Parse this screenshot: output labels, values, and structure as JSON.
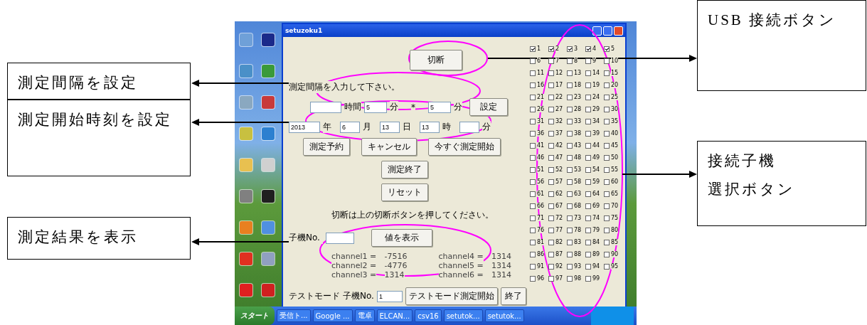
{
  "callouts": [
    {
      "text": "測定間隔を設定"
    },
    {
      "text": "測定開始時刻を設定"
    },
    {
      "text": "測定結果を表示"
    },
    {
      "text": "USB 接続ボタン"
    },
    {
      "lines": [
        "接続子機",
        "選択ボタン"
      ]
    }
  ],
  "screenshot": {
    "window": {
      "title": "setuzoku1",
      "disconnect_button": "切断",
      "interval_prompt": "測定間隔を入力して下さい。",
      "interval": {
        "hours": {
          "unit": "時間"
        },
        "minutes": {
          "value": "5",
          "unit": "分"
        },
        "separator": "*",
        "count": {
          "value": "5",
          "unit": "分"
        },
        "set_button": "設定"
      },
      "start_time": [
        {
          "value": "2013",
          "unit": "年"
        },
        {
          "value": "6",
          "unit": "月"
        },
        {
          "value": "13",
          "unit": "日"
        },
        {
          "value": "13",
          "unit": "時"
        },
        {
          "unit": "分"
        }
      ],
      "action_buttons": [
        "測定予約",
        "キャンセル",
        "今すぐ測定開始"
      ],
      "end_button": "測定終了",
      "reset_button": "リセット",
      "disconnect_message": "切断は上の切断ボタンを押してください。",
      "unit_label": "子機No.",
      "show_button": "値を表示",
      "channels": [
        {
          "name": "channel1 =",
          "value": "-7516"
        },
        {
          "name": "channel2 =",
          "value": "-4776"
        },
        {
          "name": "channel3 =",
          "value": "1314"
        },
        {
          "name": "channel4 =",
          "value": "1314"
        },
        {
          "name": "channel5 =",
          "value": "1314"
        },
        {
          "name": "channel6 =",
          "value": "1314"
        }
      ],
      "test_mode": {
        "label": "テストモード",
        "unit_label": "子機No.",
        "unit_value": "1",
        "start_button": "テストモード測定開始",
        "end_button": "終了"
      },
      "units": [
        {
          "label": "1",
          "checked": true
        },
        {
          "label": "2",
          "checked": true
        },
        {
          "label": "3",
          "checked": true
        },
        {
          "label": "4",
          "checked": true
        },
        {
          "label": "5",
          "checked": true
        },
        {
          "label": "6",
          "checked": false
        },
        {
          "label": "7",
          "checked": false
        },
        {
          "label": "8",
          "checked": false
        },
        {
          "label": "9",
          "checked": false
        },
        {
          "label": "10",
          "checked": false
        },
        {
          "label": "11",
          "checked": false
        },
        {
          "label": "12",
          "checked": false
        },
        {
          "label": "13",
          "checked": false
        },
        {
          "label": "14",
          "checked": false
        },
        {
          "label": "15",
          "checked": false
        },
        {
          "label": "16",
          "checked": false
        },
        {
          "label": "17",
          "checked": false
        },
        {
          "label": "18",
          "checked": false
        },
        {
          "label": "19",
          "checked": false
        },
        {
          "label": "20",
          "checked": false
        },
        {
          "label": "21",
          "checked": false
        },
        {
          "label": "22",
          "checked": false
        },
        {
          "label": "23",
          "checked": false
        },
        {
          "label": "24",
          "checked": false
        },
        {
          "label": "25",
          "checked": false
        },
        {
          "label": "26",
          "checked": false
        },
        {
          "label": "27",
          "checked": false
        },
        {
          "label": "28",
          "checked": false
        },
        {
          "label": "29",
          "checked": false
        },
        {
          "label": "30",
          "checked": false
        },
        {
          "label": "31",
          "checked": false
        },
        {
          "label": "32",
          "checked": false
        },
        {
          "label": "33",
          "checked": false
        },
        {
          "label": "34",
          "checked": false
        },
        {
          "label": "35",
          "checked": false
        },
        {
          "label": "36",
          "checked": false
        },
        {
          "label": "37",
          "checked": false
        },
        {
          "label": "38",
          "checked": false
        },
        {
          "label": "39",
          "checked": false
        },
        {
          "label": "40",
          "checked": false
        },
        {
          "label": "41",
          "checked": false
        },
        {
          "label": "42",
          "checked": false
        },
        {
          "label": "43",
          "checked": false
        },
        {
          "label": "44",
          "checked": false
        },
        {
          "label": "45",
          "checked": false
        },
        {
          "label": "46",
          "checked": false
        },
        {
          "label": "47",
          "checked": false
        },
        {
          "label": "48",
          "checked": false
        },
        {
          "label": "49",
          "checked": false
        },
        {
          "label": "50",
          "checked": false
        },
        {
          "label": "51",
          "checked": false
        },
        {
          "label": "52",
          "checked": false
        },
        {
          "label": "53",
          "checked": false
        },
        {
          "label": "54",
          "checked": false
        },
        {
          "label": "55",
          "checked": false
        },
        {
          "label": "56",
          "checked": false
        },
        {
          "label": "57",
          "checked": false
        },
        {
          "label": "58",
          "checked": false
        },
        {
          "label": "59",
          "checked": false
        },
        {
          "label": "60",
          "checked": false
        },
        {
          "label": "61",
          "checked": false
        },
        {
          "label": "62",
          "checked": false
        },
        {
          "label": "63",
          "checked": false
        },
        {
          "label": "64",
          "checked": false
        },
        {
          "label": "65",
          "checked": false
        },
        {
          "label": "66",
          "checked": false
        },
        {
          "label": "67",
          "checked": false
        },
        {
          "label": "68",
          "checked": false
        },
        {
          "label": "69",
          "checked": false
        },
        {
          "label": "70",
          "checked": false
        },
        {
          "label": "71",
          "checked": false
        },
        {
          "label": "72",
          "checked": false
        },
        {
          "label": "73",
          "checked": false
        },
        {
          "label": "74",
          "checked": false
        },
        {
          "label": "75",
          "checked": false
        },
        {
          "label": "76",
          "checked": false
        },
        {
          "label": "77",
          "checked": false
        },
        {
          "label": "78",
          "checked": false
        },
        {
          "label": "79",
          "checked": false
        },
        {
          "label": "80",
          "checked": false
        },
        {
          "label": "81",
          "checked": false
        },
        {
          "label": "82",
          "checked": false
        },
        {
          "label": "83",
          "checked": false
        },
        {
          "label": "84",
          "checked": false
        },
        {
          "label": "85",
          "checked": false
        },
        {
          "label": "86",
          "checked": false
        },
        {
          "label": "87",
          "checked": false
        },
        {
          "label": "88",
          "checked": false
        },
        {
          "label": "89",
          "checked": false
        },
        {
          "label": "90",
          "checked": false
        },
        {
          "label": "91",
          "checked": false
        },
        {
          "label": "92",
          "checked": false
        },
        {
          "label": "93",
          "checked": false
        },
        {
          "label": "94",
          "checked": false
        },
        {
          "label": "95",
          "checked": false
        },
        {
          "label": "96",
          "checked": false
        },
        {
          "label": "97",
          "checked": false
        },
        {
          "label": "98",
          "checked": false
        },
        {
          "label": "99",
          "checked": false
        }
      ]
    },
    "taskbar": {
      "start": "スタート",
      "tasks": [
        "受信ト...",
        "Google ...",
        "電卓",
        "ELCAN...",
        "csv16",
        "setutok...",
        "setutok..."
      ]
    }
  }
}
